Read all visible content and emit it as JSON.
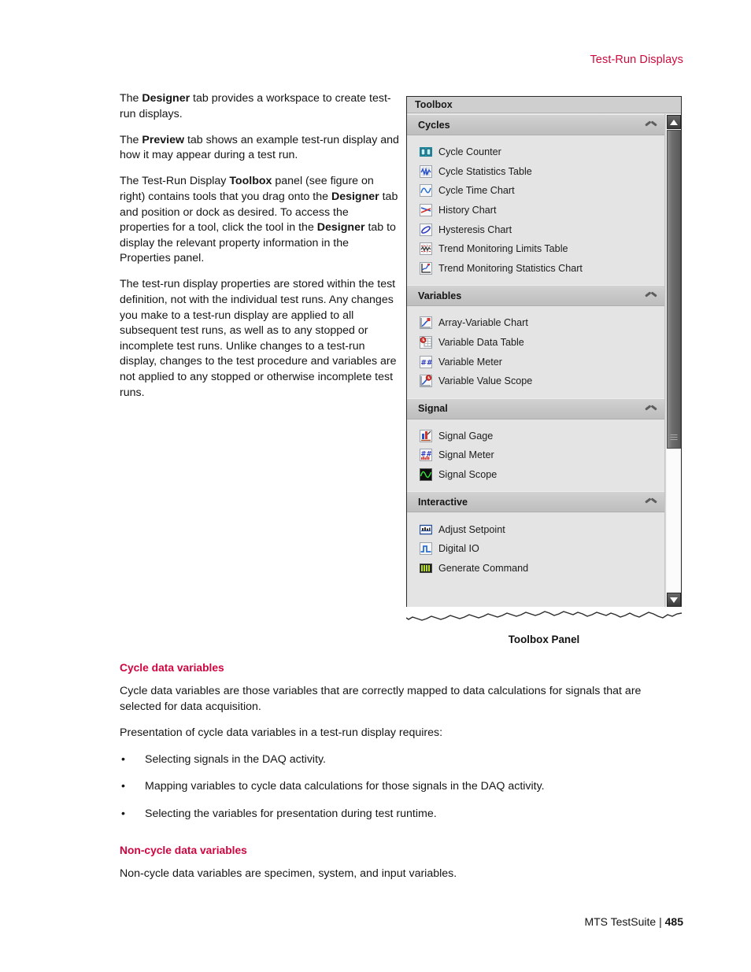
{
  "header": {
    "running_head": "Test-Run Displays"
  },
  "body": {
    "paragraphs": [
      {
        "parts": [
          {
            "t": "The ",
            "b": false
          },
          {
            "t": "Designer",
            "b": true
          },
          {
            "t": " tab provides a workspace to create test-run displays.",
            "b": false
          }
        ]
      },
      {
        "parts": [
          {
            "t": "The ",
            "b": false
          },
          {
            "t": "Preview",
            "b": true
          },
          {
            "t": " tab shows an example test-run display and how it may appear during a test run.",
            "b": false
          }
        ]
      },
      {
        "parts": [
          {
            "t": "The Test-Run Display ",
            "b": false
          },
          {
            "t": "Toolbox",
            "b": true
          },
          {
            "t": " panel (see figure on right) contains tools that you drag onto the ",
            "b": false
          },
          {
            "t": "Designer",
            "b": true
          },
          {
            "t": " tab and position or dock as desired. To access the properties for a tool, click the tool in the ",
            "b": false
          },
          {
            "t": "Designer",
            "b": true
          },
          {
            "t": " tab to display the relevant property information in the Properties panel.",
            "b": false
          }
        ]
      },
      {
        "parts": [
          {
            "t": "The test-run display properties are stored within the test definition, not with the individual test runs. Any changes you make to a test-run display are applied to all subsequent test runs, as well as to any stopped or incomplete test runs. Unlike changes to a test-run display, changes to the test procedure and variables are not applied to any stopped or otherwise incomplete test runs.",
            "b": false
          }
        ]
      }
    ]
  },
  "figure": {
    "caption": "Toolbox Panel",
    "toolbox": {
      "title": "Toolbox",
      "scrollbar": {
        "up_arrow": "scroll-up-arrow",
        "down_arrow": "scroll-down-arrow"
      },
      "sections": [
        {
          "label": "Cycles",
          "collapse_state": "expanded",
          "items": [
            {
              "label": "Cycle Counter",
              "icon": "cycle-counter-icon"
            },
            {
              "label": "Cycle Statistics Table",
              "icon": "cycle-statistics-table-icon"
            },
            {
              "label": "Cycle Time Chart",
              "icon": "cycle-time-chart-icon"
            },
            {
              "label": "History Chart",
              "icon": "history-chart-icon"
            },
            {
              "label": "Hysteresis Chart",
              "icon": "hysteresis-chart-icon"
            },
            {
              "label": "Trend Monitoring Limits Table",
              "icon": "trend-monitoring-limits-table-icon"
            },
            {
              "label": "Trend Monitoring Statistics Chart",
              "icon": "trend-monitoring-statistics-chart-icon"
            }
          ]
        },
        {
          "label": "Variables",
          "collapse_state": "expanded",
          "items": [
            {
              "label": "Array-Variable Chart",
              "icon": "array-variable-chart-icon"
            },
            {
              "label": "Variable Data Table",
              "icon": "variable-data-table-icon"
            },
            {
              "label": "Variable Meter",
              "icon": "variable-meter-icon"
            },
            {
              "label": "Variable Value Scope",
              "icon": "variable-value-scope-icon"
            }
          ]
        },
        {
          "label": "Signal",
          "collapse_state": "expanded",
          "items": [
            {
              "label": "Signal Gage",
              "icon": "signal-gage-icon"
            },
            {
              "label": "Signal Meter",
              "icon": "signal-meter-icon"
            },
            {
              "label": "Signal Scope",
              "icon": "signal-scope-icon"
            }
          ]
        },
        {
          "label": "Interactive",
          "collapse_state": "expanded",
          "items": [
            {
              "label": "Adjust Setpoint",
              "icon": "adjust-setpoint-icon"
            },
            {
              "label": "Digital IO",
              "icon": "digital-io-icon"
            },
            {
              "label": "Generate Command",
              "icon": "generate-command-icon"
            }
          ]
        }
      ]
    }
  },
  "sections": {
    "cycle_data": {
      "title": "Cycle data variables",
      "paragraphs": [
        "Cycle data variables are those variables that are correctly mapped to data calculations for signals that are selected for data acquisition.",
        "Presentation of cycle data variables in a test-run display requires:"
      ],
      "bullet_marker": "•",
      "bullets": [
        "Selecting signals in the DAQ activity.",
        "Mapping variables to cycle data calculations for those signals in the DAQ activity.",
        "Selecting the variables for presentation during test runtime."
      ]
    },
    "non_cycle_data": {
      "title": "Non-cycle data variables",
      "paragraphs": [
        "Non-cycle data variables are specimen, system, and input variables."
      ]
    }
  },
  "footer": {
    "product": "MTS TestSuite |",
    "page_number": "485"
  },
  "colors": {
    "accent_heading": "#d0053f",
    "running_head": "#cf0a3c",
    "panel_bg": "#e4e4e4",
    "section_header_bg": "#c6c6c6"
  }
}
